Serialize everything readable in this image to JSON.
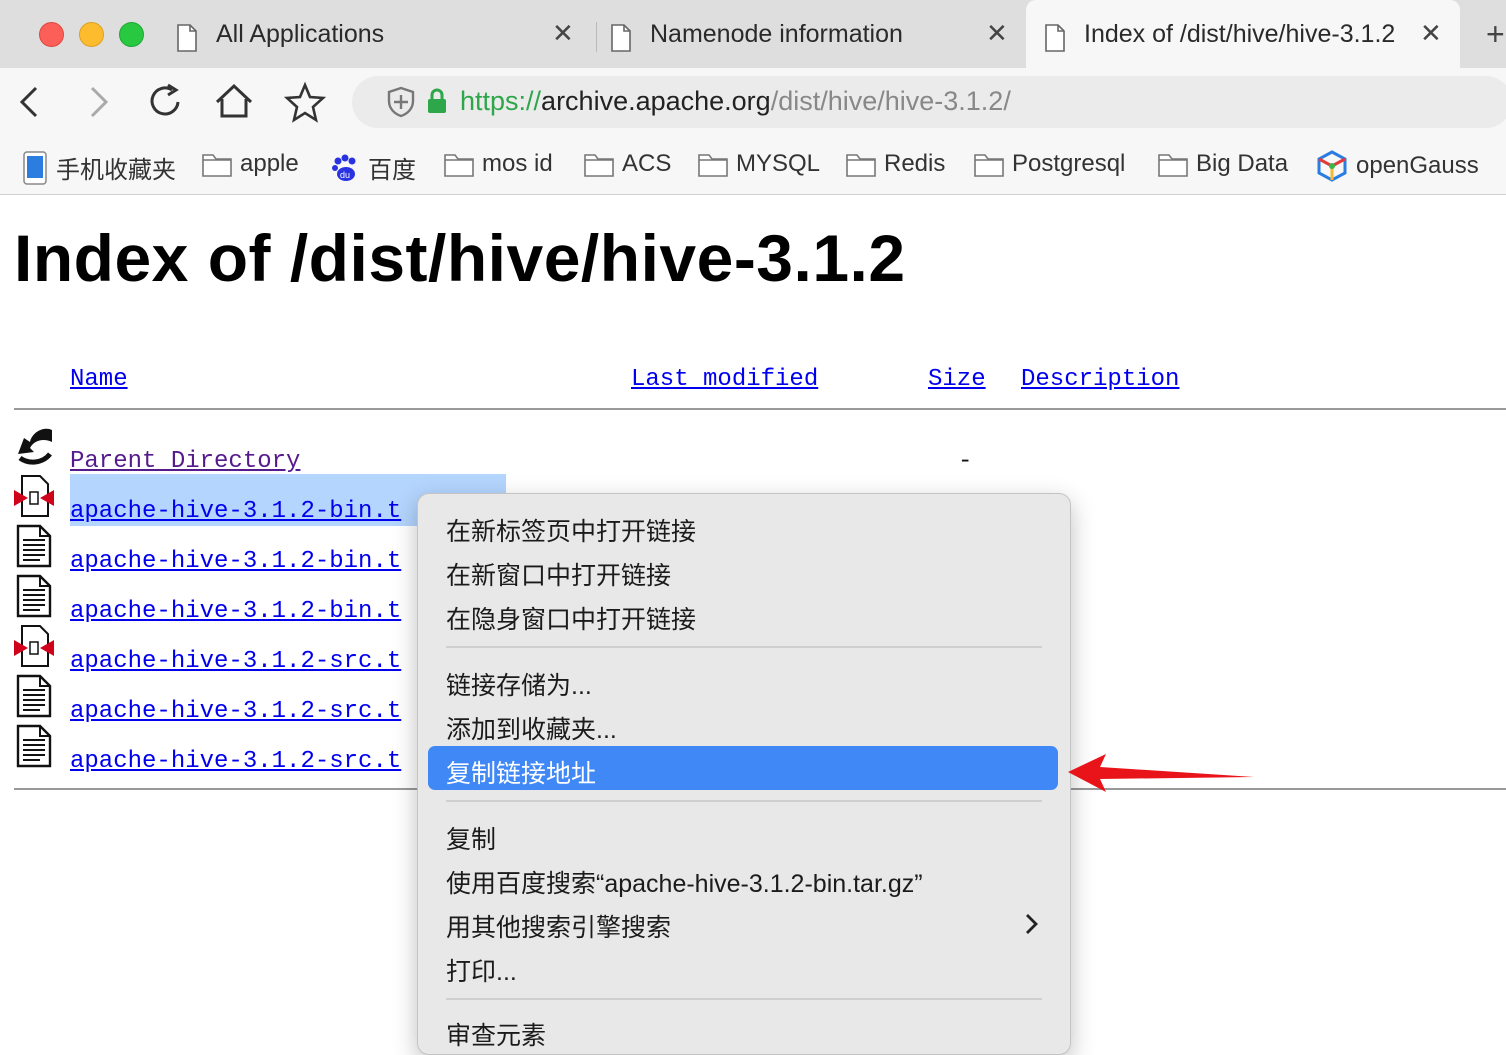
{
  "tabs": [
    {
      "label": "All Applications"
    },
    {
      "label": "Namenode information"
    },
    {
      "label": "Index of /dist/hive/hive-3.1.2"
    }
  ],
  "close_glyph": "✕",
  "new_tab_glyph": "+",
  "url": {
    "scheme": "https://",
    "host": "archive.apache.org",
    "path": "/dist/hive/hive-3.1.2/"
  },
  "bookmarks": [
    {
      "label": "手机收藏夹",
      "icon": "phone-icon"
    },
    {
      "label": "apple",
      "icon": "folder-icon"
    },
    {
      "label": "百度",
      "icon": "baidu-paw-icon"
    },
    {
      "label": "mos id",
      "icon": "folder-icon"
    },
    {
      "label": "ACS",
      "icon": "folder-icon"
    },
    {
      "label": "MYSQL",
      "icon": "folder-icon"
    },
    {
      "label": "Redis",
      "icon": "folder-icon"
    },
    {
      "label": "Postgresql",
      "icon": "folder-icon"
    },
    {
      "label": "Big Data",
      "icon": "folder-icon"
    },
    {
      "label": "openGauss",
      "icon": "opengauss-logo-icon"
    }
  ],
  "page": {
    "title": "Index of /dist/hive/hive-3.1.2",
    "columns": {
      "name": "Name",
      "last_modified": "Last modified",
      "size": "Size",
      "description": "Description"
    },
    "rows": [
      {
        "name": "Parent Directory",
        "size": "-",
        "icon": "back-arrow-icon"
      },
      {
        "name": "apache-hive-3.1.2-bin.t",
        "icon": "compressed-file-icon"
      },
      {
        "name": "apache-hive-3.1.2-bin.t",
        "icon": "text-file-icon"
      },
      {
        "name": "apache-hive-3.1.2-bin.t",
        "icon": "text-file-icon"
      },
      {
        "name": "apache-hive-3.1.2-src.t",
        "icon": "compressed-file-icon"
      },
      {
        "name": "apache-hive-3.1.2-src.t",
        "icon": "text-file-icon"
      },
      {
        "name": "apache-hive-3.1.2-src.t",
        "icon": "text-file-icon"
      }
    ]
  },
  "context_menu": {
    "items": [
      "在新标签页中打开链接",
      "在新窗口中打开链接",
      "在隐身窗口中打开链接",
      "链接存储为...",
      "添加到收藏夹...",
      "复制链接地址",
      "复制",
      "使用百度搜索“apache-hive-3.1.2-bin.tar.gz”",
      "用其他搜索引擎搜索",
      "打印...",
      "审查元素"
    ],
    "highlighted": "复制链接地址",
    "submenu_glyph": "›",
    "highlight_color": "#3f88f6"
  },
  "colors": {
    "link": "#0000ee",
    "visited": "#551a8b",
    "annotation_arrow": "#e8141a",
    "secure": "#2ea64a"
  }
}
